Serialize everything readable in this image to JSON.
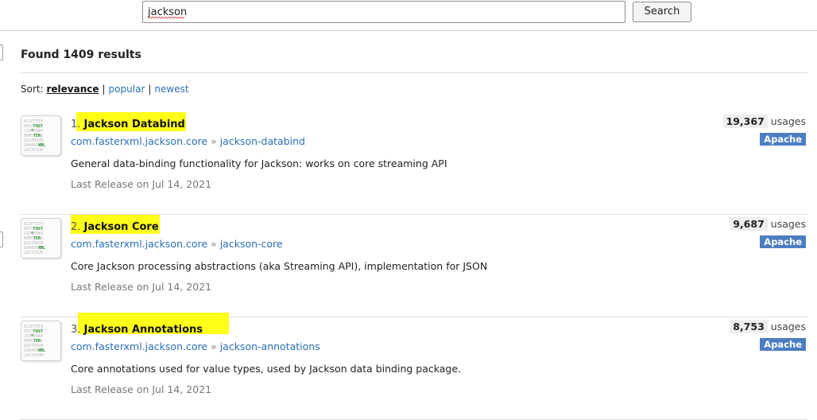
{
  "search": {
    "value": "jackson",
    "button_label": "Search"
  },
  "results_title": "Found 1409 results",
  "sort": {
    "label": "Sort:",
    "options": [
      {
        "label": "relevance",
        "active": true
      },
      {
        "label": "popular",
        "active": false
      },
      {
        "label": "newest",
        "active": false
      }
    ],
    "separator": "|"
  },
  "results": [
    {
      "number": "1.",
      "name": "Jackson Databind",
      "group": "com.fasterxml.jackson.core",
      "artifact": "jackson-databind",
      "separator": "»",
      "description": "General data-binding functionality for Jackson: works on core streaming API",
      "release": "Last Release on Jul 14, 2021",
      "usages_count": "19,367",
      "usages_label": "usages",
      "license": "Apache"
    },
    {
      "number": "2.",
      "name": "Jackson Core",
      "group": "com.fasterxml.jackson.core",
      "artifact": "jackson-core",
      "separator": "»",
      "description": "Core Jackson processing abstractions (aka Streaming API), implementation for JSON",
      "release": "Last Release on Jul 14, 2021",
      "usages_count": "9,687",
      "usages_label": "usages",
      "license": "Apache"
    },
    {
      "number": "3.",
      "name": "Jackson Annotations",
      "group": "com.fasterxml.jackson.core",
      "artifact": "jackson-annotations",
      "separator": "»",
      "description": "Core annotations used for value types, used by Jackson data binding package.",
      "release": "Last Release on Jul 14, 2021",
      "usages_count": "8,753",
      "usages_label": "usages",
      "license": "Apache"
    }
  ],
  "colors": {
    "link": "#2a6fb5",
    "highlight": "#ffff1a",
    "license_badge": "#4c7ec2",
    "divider": "#dedede"
  },
  "icons": {
    "result_logo": "fasterxml-jackson-logo-icon"
  }
}
